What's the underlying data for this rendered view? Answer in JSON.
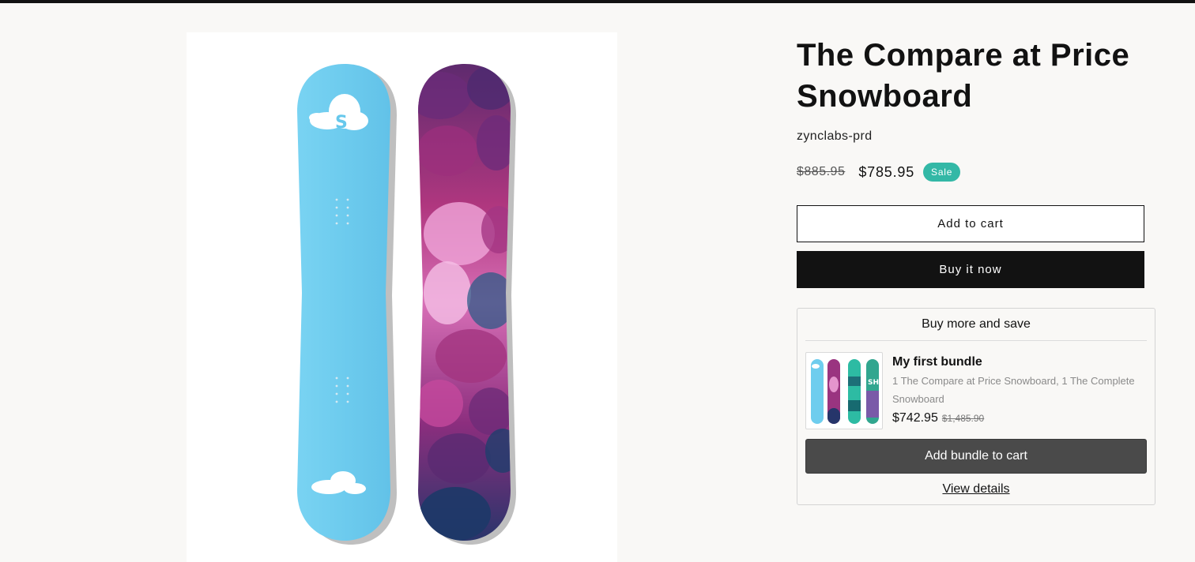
{
  "product": {
    "title": "The Compare at Price Snowboard",
    "vendor": "zynclabs-prd",
    "compare_price": "$885.95",
    "sale_price": "$785.95",
    "badge": "Sale",
    "add_to_cart_label": "Add to cart",
    "buy_now_label": "Buy it now",
    "image_description_icons": [
      "snowboard-blue",
      "snowboard-purple"
    ]
  },
  "bundle": {
    "heading": "Buy more and save",
    "name": "My first bundle",
    "description": "1 The Compare at Price Snowboard, 1 The Complete Snowboard",
    "price": "$742.95",
    "compare_price": "$1,485.90",
    "add_label": "Add bundle to cart",
    "details_label": "View details"
  },
  "colors": {
    "sale_badge": "#33b8a6",
    "primary_button": "#121212",
    "bundle_button": "#4a4a4a",
    "board_blue": "#6ecdee",
    "board_purple": "#8a2a78"
  }
}
